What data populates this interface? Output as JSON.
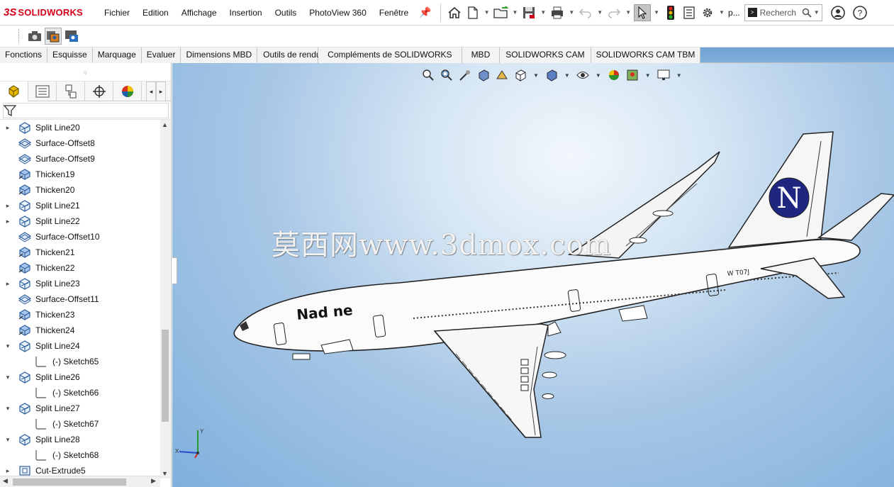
{
  "app": {
    "brand": "SOLIDWORKS",
    "menu": [
      "Fichier",
      "Edition",
      "Affichage",
      "Insertion",
      "Outils",
      "PhotoView 360",
      "Fenêtre"
    ],
    "user_short": "p...",
    "search": {
      "placeholder": "Recherch"
    }
  },
  "command_tabs": [
    "Fonctions",
    "Esquisse",
    "Marquage",
    "Evaluer",
    "Dimensions MBD",
    "Outils de rendu",
    "Compléments de SOLIDWORKS",
    "MBD",
    "SOLIDWORKS CAM",
    "SOLIDWORKS CAM TBM"
  ],
  "feature_tree": [
    {
      "label": "Split Line20",
      "kind": "split",
      "expand": "▸"
    },
    {
      "label": "Surface-Offset8",
      "kind": "surface",
      "expand": ""
    },
    {
      "label": "Surface-Offset9",
      "kind": "surface",
      "expand": ""
    },
    {
      "label": "Thicken19",
      "kind": "thicken",
      "expand": ""
    },
    {
      "label": "Thicken20",
      "kind": "thicken",
      "expand": ""
    },
    {
      "label": "Split Line21",
      "kind": "split",
      "expand": "▸"
    },
    {
      "label": "Split Line22",
      "kind": "split",
      "expand": "▸"
    },
    {
      "label": "Surface-Offset10",
      "kind": "surface",
      "expand": ""
    },
    {
      "label": "Thicken21",
      "kind": "thicken",
      "expand": ""
    },
    {
      "label": "Thicken22",
      "kind": "thicken",
      "expand": ""
    },
    {
      "label": "Split Line23",
      "kind": "split",
      "expand": "▸"
    },
    {
      "label": "Surface-Offset11",
      "kind": "surface",
      "expand": ""
    },
    {
      "label": "Thicken23",
      "kind": "thicken",
      "expand": ""
    },
    {
      "label": "Thicken24",
      "kind": "thicken",
      "expand": ""
    },
    {
      "label": "Split Line24",
      "kind": "split",
      "expand": "▾"
    },
    {
      "label": "(-) Sketch65",
      "kind": "sketch",
      "expand": "",
      "child": true
    },
    {
      "label": "Split Line26",
      "kind": "split",
      "expand": "▾"
    },
    {
      "label": "(-) Sketch66",
      "kind": "sketch",
      "expand": "",
      "child": true
    },
    {
      "label": "Split Line27",
      "kind": "split",
      "expand": "▾"
    },
    {
      "label": "(-) Sketch67",
      "kind": "sketch",
      "expand": "",
      "child": true
    },
    {
      "label": "Split Line28",
      "kind": "split",
      "expand": "▾"
    },
    {
      "label": "(-) Sketch68",
      "kind": "sketch",
      "expand": "",
      "child": true
    },
    {
      "label": "Cut-Extrude5",
      "kind": "cut",
      "expand": "▸"
    }
  ],
  "viewport": {
    "watermark": "莫西网www.3dmox.com",
    "airplane": {
      "body_text": "Nad ne",
      "tail_letter": "N",
      "rear_text": "W T07J"
    },
    "colors": {
      "background_center": "#f2f7fc",
      "background_edge": "#7fb0dc",
      "tail_logo": "#1f2680"
    }
  }
}
